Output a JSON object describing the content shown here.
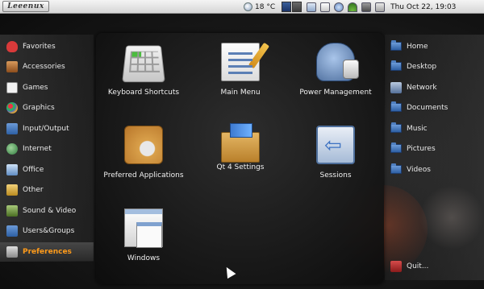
{
  "top_panel": {
    "logo_text": "Leeenux",
    "temperature": "18 °C",
    "clock": "Thu Oct 22, 19:03",
    "workspaces": [
      {
        "active": true
      },
      {
        "active": false
      }
    ],
    "tray_icons": [
      "pager-icon",
      "battery-icon",
      "network-manager-icon",
      "wifi-icon",
      "sound-icon",
      "keyboard-layout-icon"
    ]
  },
  "categories": [
    {
      "label": "Favorites",
      "icon": "heart-icon",
      "color": "#d93a3a",
      "selected": false
    },
    {
      "label": "Accessories",
      "icon": "accessories-icon",
      "color": "#c77d3a",
      "selected": false
    },
    {
      "label": "Games",
      "icon": "cards-icon",
      "color": "#e0e0e0",
      "selected": false
    },
    {
      "label": "Graphics",
      "icon": "palette-icon",
      "color": "#e3a637",
      "selected": false
    },
    {
      "label": "Input/Output",
      "icon": "folder-icon",
      "color": "#3f7bcc",
      "selected": false
    },
    {
      "label": "Internet",
      "icon": "globe-icon",
      "color": "#3f9b52",
      "selected": false
    },
    {
      "label": "Office",
      "icon": "office-icon",
      "color": "#6aa3d8",
      "selected": false
    },
    {
      "label": "Other",
      "icon": "other-icon",
      "color": "#d9b13a",
      "selected": false
    },
    {
      "label": "Sound & Video",
      "icon": "media-icon",
      "color": "#7ba04c",
      "selected": false
    },
    {
      "label": "Users&Groups",
      "icon": "users-icon",
      "color": "#3f7bcc",
      "selected": false
    },
    {
      "label": "Preferences",
      "icon": "preferences-icon",
      "color": "#b8b8b8",
      "selected": true
    }
  ],
  "apps": [
    {
      "label": "Keyboard Shortcuts",
      "icon": "keyboard-icon"
    },
    {
      "label": "Main Menu",
      "icon": "main-menu-icon"
    },
    {
      "label": "Power Management",
      "icon": "power-management-icon"
    },
    {
      "label": "Preferred Applications",
      "icon": "preferred-applications-icon"
    },
    {
      "label": "Qt 4 Settings",
      "icon": "qt-settings-icon"
    },
    {
      "label": "Sessions",
      "icon": "sessions-icon"
    },
    {
      "label": "Windows",
      "icon": "windows-icon"
    }
  ],
  "places": [
    {
      "label": "Home",
      "icon": "folder-icon"
    },
    {
      "label": "Desktop",
      "icon": "folder-icon"
    },
    {
      "label": "Network",
      "icon": "network-icon"
    },
    {
      "label": "Documents",
      "icon": "folder-icon"
    },
    {
      "label": "Music",
      "icon": "folder-icon"
    },
    {
      "label": "Pictures",
      "icon": "folder-icon"
    },
    {
      "label": "Videos",
      "icon": "folder-icon"
    }
  ],
  "quit_label": "Quit...",
  "colors": {
    "accent": "#ff9b1a",
    "panel": "#e0e0e0"
  }
}
